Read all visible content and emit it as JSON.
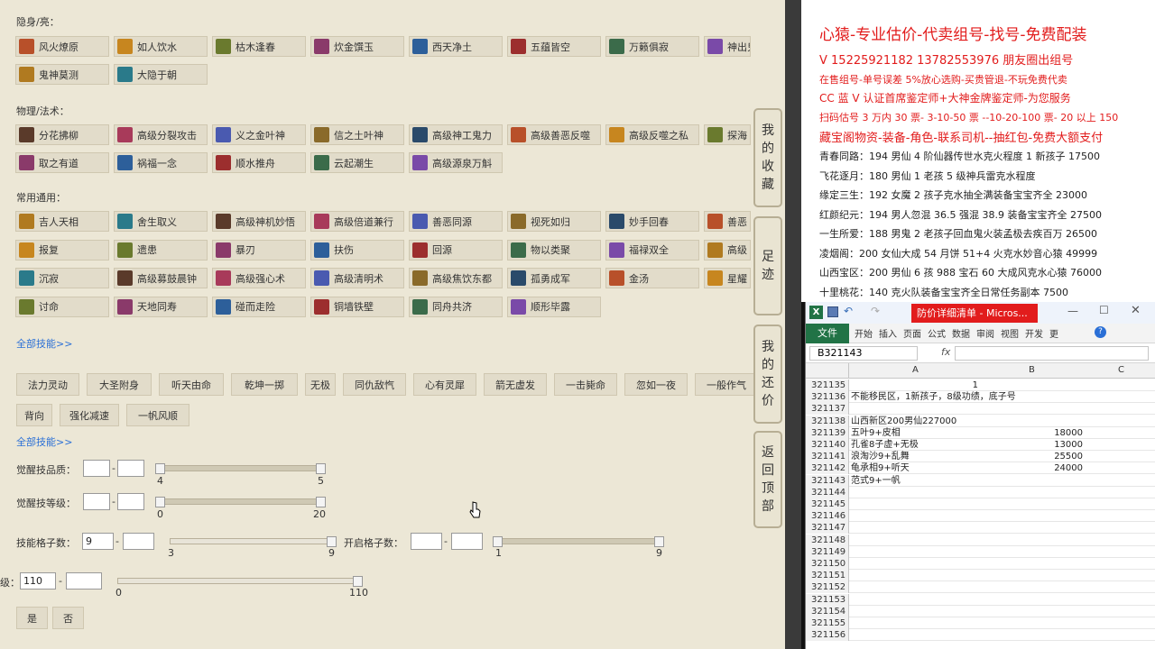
{
  "sections": {
    "hidden_label": "隐身/亮：",
    "physical_label": "物理/法术：",
    "common_label": "常用通用：",
    "all_skills_1": "全部技能>>",
    "all_skills_2": "全部技能>>"
  },
  "hidden_skills": [
    "风火燎原",
    "如人饮水",
    "枯木逢春",
    "炊金馔玉",
    "西天净土",
    "五蕴皆空",
    "万籁俱寂",
    "神出鬼没",
    "鬼神莫测",
    "大隐于朝"
  ],
  "physical_skills": [
    "分花拂柳",
    "高级分裂攻击",
    "义之金叶神",
    "信之土叶神",
    "高级神工鬼力",
    "高级善恶反噬",
    "高级反噬之私",
    "探海",
    "取之有道",
    "祸福一念",
    "顺水推舟",
    "云起潮生",
    "高级源泉万斛"
  ],
  "common_skills": [
    "吉人天相",
    "舍生取义",
    "高级神机妙悟",
    "高级倍道兼行",
    "善恶同源",
    "视死如归",
    "妙手回春",
    "善恶",
    "报复",
    "遗患",
    "暴刃",
    "扶伤",
    "回源",
    "物以类聚",
    "福禄双全",
    "高级",
    "沉寂",
    "高级募鼓晨钟",
    "高级强心术",
    "高级清明术",
    "高级焦饮东都",
    "孤勇成军",
    "金汤",
    "星耀",
    "讨命",
    "天地同寿",
    "碰而走险",
    "铜墙铁壁",
    "同舟共济",
    "顺形毕露"
  ],
  "tag_buttons": [
    "法力灵动",
    "大圣附身",
    "听天由命",
    "乾坤一掷",
    "无极",
    "同仇敌忾",
    "心有灵犀",
    "箭无虚发",
    "一击毙命",
    "忽如一夜",
    "一般作气",
    "背向",
    "强化减速",
    "一帆风顺"
  ],
  "filters": {
    "awaken_quality": {
      "label": "觉醒技品质：",
      "min_value": "",
      "max_value": "",
      "range_min": "4",
      "range_max": "5"
    },
    "awaken_level": {
      "label": "觉醒技等级：",
      "min_value": "",
      "max_value": "",
      "range_min": "0",
      "range_max": "20"
    },
    "skill_slots": {
      "label": "技能格子数：",
      "min_value": "9",
      "max_value": "",
      "range_min": "3",
      "range_max": "9"
    },
    "open_slots": {
      "label": "开启格子数：",
      "min_value": "",
      "max_value": "",
      "range_min": "1",
      "range_max": "9"
    },
    "level": {
      "label": "级：",
      "min_value": "110",
      "max_value": "",
      "range_min": "0",
      "range_max": "110"
    },
    "dash": "-"
  },
  "yes_no": {
    "yes": "是",
    "no": "否"
  },
  "side_tabs": {
    "favorites": "我的收藏",
    "footprints": "足迹",
    "bargain": "我的还价",
    "back_top": "返回顶部"
  },
  "ads": [
    "心猿-专业估价-代卖组号-找号-免费配装",
    "V 15225921182   13782553976 朋友圈出组号",
    "在售组号-单号误差 5%放心选购-买贵管退-不玩免费代卖",
    "CC 蓝 V 认证首席鉴定师+大神金牌鉴定师-为您服务",
    "扫码估号 3 万内 30 票- 3-10-50 票  --10-20-100 票- 20 以上 150",
    "藏宝阁物资-装备-角色-联系司机--抽红包-免费大额支付"
  ],
  "listings": [
    "青春同路：194 男仙 4 阶仙器传世水克火程度 1 新孩子 17500",
    "飞花逐月：180 男仙 1 老孩 5 级神兵雷克水程度",
    "缘定三生：192 女魔 2 孩子克水抽全满装备宝宝齐全 23000",
    "红颜纪元：194 男人忽混 36.5 强混 38.9 装备宝宝齐全 27500",
    "一生所爱：188 男鬼 2 老孩子回血鬼火装孟极去疾百万 26500",
    "凌烟阁：200 女仙大成 54 月饼 51+4 火克水妙音心猿 49999",
    "山西宝区：200 男仙 6 孩 988 宝石 60 大成风克水心猿 76000",
    "十里桃花：140 克火队装备宝宝齐全日常任务副本 7500"
  ],
  "excel": {
    "title": "防价详细清单 - Micros...",
    "file_tab": "文件",
    "ribbon_tabs": [
      "开始",
      "插入",
      "页面",
      "公式",
      "数据",
      "审阅",
      "视图",
      "开发",
      "更"
    ],
    "name_box": "B321143",
    "fx": "fx",
    "col_a": "A",
    "col_b": "B",
    "col_c": "C",
    "rows": [
      {
        "n": "321135",
        "a": "1",
        "b": ""
      },
      {
        "n": "321136",
        "a": "不能移民区，1新孩子，8级功绩，底子号",
        "b": ""
      },
      {
        "n": "321137",
        "a": "",
        "b": ""
      },
      {
        "n": "321138",
        "a": "山西新区200男仙227000",
        "b": ""
      },
      {
        "n": "321139",
        "a": "五叶9+皮相",
        "b": "18000"
      },
      {
        "n": "321140",
        "a": "孔雀8子虚+无极",
        "b": "13000"
      },
      {
        "n": "321141",
        "a": "浪淘沙9+乱舞",
        "b": "25500"
      },
      {
        "n": "321142",
        "a": "龟承相9+听天",
        "b": "24000"
      },
      {
        "n": "321143",
        "a": "范式9+一帆",
        "b": ""
      },
      {
        "n": "321144",
        "a": "",
        "b": ""
      },
      {
        "n": "321145",
        "a": "",
        "b": ""
      },
      {
        "n": "321146",
        "a": "",
        "b": ""
      },
      {
        "n": "321147",
        "a": "",
        "b": ""
      },
      {
        "n": "321148",
        "a": "",
        "b": ""
      },
      {
        "n": "321149",
        "a": "",
        "b": ""
      },
      {
        "n": "321150",
        "a": "",
        "b": ""
      },
      {
        "n": "321151",
        "a": "",
        "b": ""
      },
      {
        "n": "321152",
        "a": "",
        "b": ""
      },
      {
        "n": "321153",
        "a": "",
        "b": ""
      },
      {
        "n": "321154",
        "a": "",
        "b": ""
      },
      {
        "n": "321155",
        "a": "",
        "b": ""
      },
      {
        "n": "321156",
        "a": "",
        "b": ""
      }
    ]
  },
  "colors": {
    "panel_bg": "#ece7d6",
    "accent_red": "#e21c1c",
    "link_blue": "#2a6fd6",
    "excel_green": "#217346"
  },
  "icons": [
    "skill-icon",
    "cursor-icon",
    "excel-icon",
    "save-icon",
    "undo-icon",
    "redo-icon",
    "help-icon",
    "minimize-icon",
    "maximize-icon",
    "close-icon"
  ]
}
